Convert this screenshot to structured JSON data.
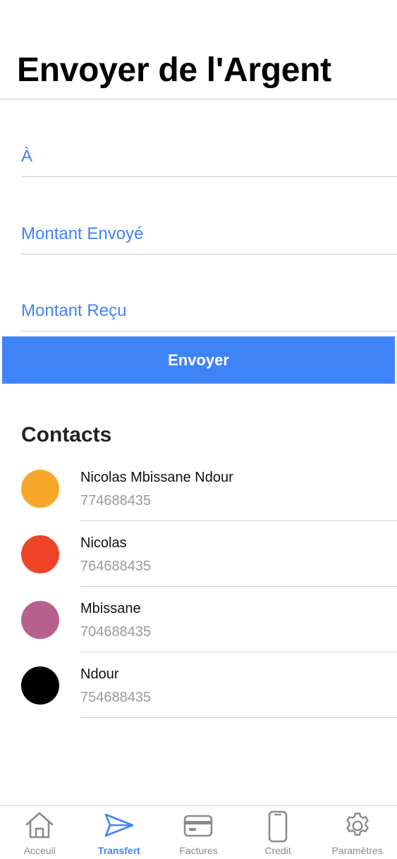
{
  "header": {
    "title": "Envoyer de l'Argent"
  },
  "form": {
    "to_placeholder": "À",
    "amount_sent_placeholder": "Montant Envoyé",
    "amount_received_placeholder": "Montant Reçu",
    "send_label": "Envoyer"
  },
  "contacts": {
    "title": "Contacts",
    "items": [
      {
        "name": "Nicolas Mbissane Ndour",
        "phone": "774688435",
        "color": "#f8a62a"
      },
      {
        "name": "Nicolas",
        "phone": "764688435",
        "color": "#ef4326"
      },
      {
        "name": "Mbissane",
        "phone": "704688435",
        "color": "#b7608f"
      },
      {
        "name": "Ndour",
        "phone": "754688435",
        "color": "#000000"
      }
    ]
  },
  "tabbar": {
    "active": "transfert",
    "tabs": [
      {
        "id": "accueil",
        "label": "Acceuil",
        "icon": "home-icon"
      },
      {
        "id": "transfert",
        "label": "Transfert",
        "icon": "send-icon"
      },
      {
        "id": "factures",
        "label": "Factures",
        "icon": "card-icon"
      },
      {
        "id": "credit",
        "label": "Credit",
        "icon": "phone-icon"
      },
      {
        "id": "parametres",
        "label": "Paramètres",
        "icon": "gear-icon"
      }
    ]
  },
  "colors": {
    "accent": "#3f83f8",
    "inactive": "#8a8a8a"
  }
}
